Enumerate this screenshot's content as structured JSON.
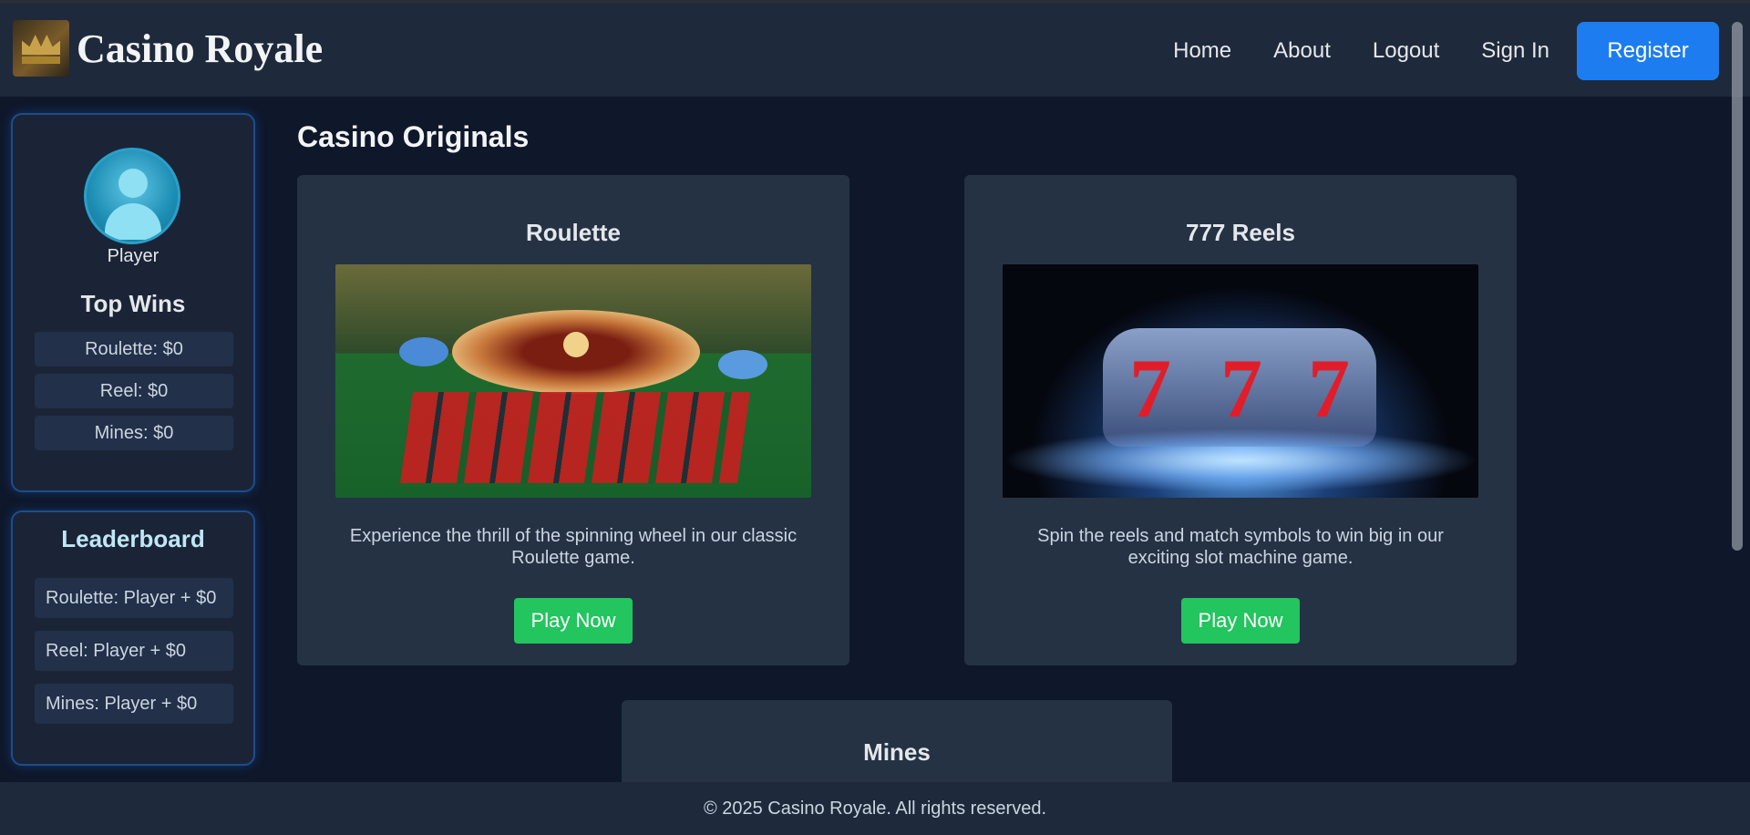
{
  "brand": {
    "name": "Casino Royale"
  },
  "nav": {
    "items": [
      "Home",
      "About",
      "Logout",
      "Sign In"
    ],
    "register_label": "Register"
  },
  "profile": {
    "player_name": "Player",
    "top_wins_title": "Top Wins",
    "top_wins": [
      "Roulette: $0",
      "Reel: $0",
      "Mines: $0"
    ]
  },
  "leaderboard": {
    "title": "Leaderboard",
    "entries": [
      "Roulette: Player + $0",
      "Reel: Player + $0",
      "Mines: Player + $0"
    ]
  },
  "main": {
    "title": "Casino Originals",
    "games": [
      {
        "title": "Roulette",
        "description": "Experience the thrill of the spinning wheel in our classic Roulette game.",
        "button": "Play Now"
      },
      {
        "title": "777 Reels",
        "description": "Spin the reels and match symbols to win big in our exciting slot machine game.",
        "button": "Play Now"
      },
      {
        "title": "Mines"
      }
    ]
  },
  "footer": {
    "text": "© 2025 Casino Royale. All rights reserved."
  },
  "colors": {
    "background": "#0f172a",
    "header": "#1e293b",
    "card": "#243244",
    "accent_blue": "#1d7df0",
    "play_green": "#22c55e"
  }
}
